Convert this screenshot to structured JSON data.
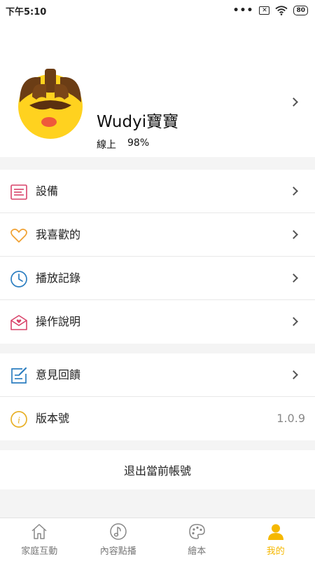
{
  "status_bar": {
    "time": "下午5:10",
    "dots": "•••",
    "sim": "✕",
    "battery": "80"
  },
  "profile": {
    "name": "Wudyi寶寶",
    "status": "線上",
    "battery": "98%"
  },
  "menu_main": [
    {
      "label": "設備",
      "icon": "device-list-icon",
      "color": "#d9436a"
    },
    {
      "label": "我喜歡的",
      "icon": "heart-icon",
      "color": "#f0a030"
    },
    {
      "label": "播放記錄",
      "icon": "clock-icon",
      "color": "#2d7fc1"
    },
    {
      "label": "操作說明",
      "icon": "mail-heart-icon",
      "color": "#d9436a"
    }
  ],
  "menu_other": [
    {
      "label": "意見回饋",
      "icon": "edit-icon",
      "color": "#2d7fc1"
    },
    {
      "label": "版本號",
      "icon": "info-icon",
      "color": "#e8b028",
      "value": "1.0.9"
    }
  ],
  "logout_label": "退出當前帳號",
  "tabs": [
    {
      "label": "家庭互動",
      "icon": "home-icon",
      "active": false
    },
    {
      "label": "內容點播",
      "icon": "music-note-icon",
      "active": false
    },
    {
      "label": "繪本",
      "icon": "palette-icon",
      "active": false
    },
    {
      "label": "我的",
      "icon": "person-icon",
      "active": true
    }
  ],
  "colors": {
    "accent": "#f5b800",
    "divider": "#f4f4f4"
  }
}
